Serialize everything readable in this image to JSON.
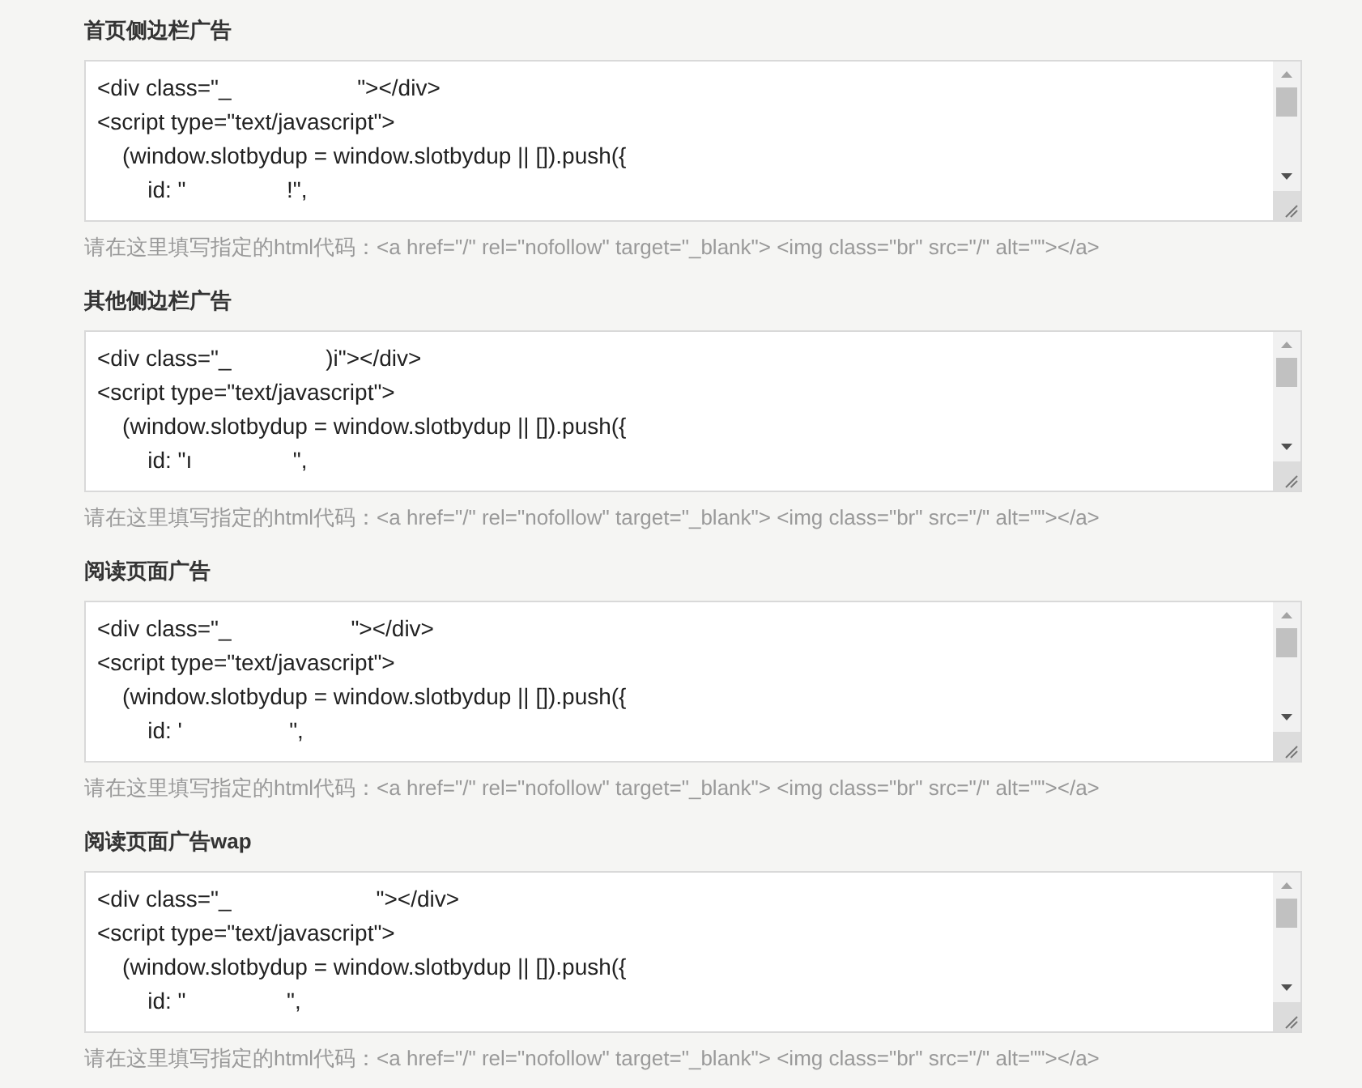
{
  "sections": [
    {
      "title": "首页侧边栏广告",
      "code_lines": [
        "<div class=\"_                    \"></div>",
        "<script type=\"text/javascript\">",
        "    (window.slotbydup = window.slotbydup || []).push({",
        "        id: \"                !\","
      ],
      "hint": "请在这里填写指定的html代码：<a href=\"/\" rel=\"nofollow\" target=\"_blank\"> <img class=\"br\" src=\"/\" alt=\"\"></a>"
    },
    {
      "title": "其他侧边栏广告",
      "code_lines": [
        "<div class=\"_               )i\"></div>",
        "<script type=\"text/javascript\">",
        "    (window.slotbydup = window.slotbydup || []).push({",
        "        id: \"ı                \","
      ],
      "hint": "请在这里填写指定的html代码：<a href=\"/\" rel=\"nofollow\" target=\"_blank\"> <img class=\"br\" src=\"/\" alt=\"\"></a>"
    },
    {
      "title": "阅读页面广告",
      "code_lines": [
        "<div class=\"_                   \"></div>",
        "<script type=\"text/javascript\">",
        "    (window.slotbydup = window.slotbydup || []).push({",
        "        id: '                 \","
      ],
      "hint": "请在这里填写指定的html代码：<a href=\"/\" rel=\"nofollow\" target=\"_blank\"> <img class=\"br\" src=\"/\" alt=\"\"></a>"
    },
    {
      "title": "阅读页面广告wap",
      "code_lines": [
        "<div class=\"_                       \"></div>",
        "<script type=\"text/javascript\">",
        "    (window.slotbydup = window.slotbydup || []).push({",
        "        id: \"                \","
      ],
      "hint": "请在这里填写指定的html代码：<a href=\"/\" rel=\"nofollow\" target=\"_blank\"> <img class=\"br\" src=\"/\" alt=\"\"></a>"
    }
  ]
}
